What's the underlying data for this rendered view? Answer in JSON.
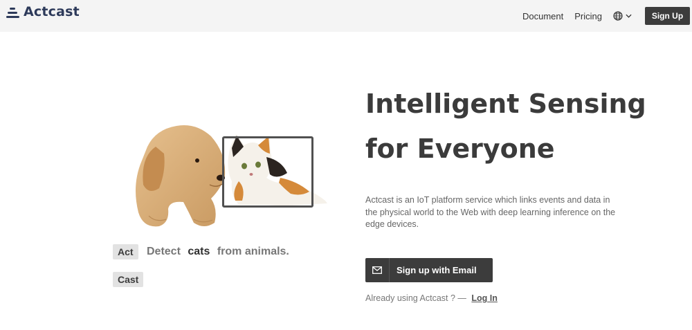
{
  "header": {
    "logo": "Actcast",
    "nav": {
      "document": "Document",
      "pricing": "Pricing",
      "signup": "Sign Up"
    },
    "icons": {
      "language": "globe-icon",
      "dropdown": "chevron-down-icon"
    }
  },
  "hero": {
    "tags": {
      "act": "Act",
      "cast": "Cast"
    },
    "detect": {
      "prefix": "Detect",
      "subject": "cats",
      "suffix": "from animals."
    },
    "title_line1": "Intelligent Sensing",
    "title_line2": "for Everyone",
    "description": "Actcast is an IoT platform service which links events and data in the physical world to the Web with deep learning inference on the edge devices.",
    "email_button": "Sign up with Email",
    "login_prompt": "Already using Actcast ? —",
    "login_link": "Log In"
  },
  "colors": {
    "dark": "#3c3c3c",
    "header_bg": "#f4f4f4",
    "brand": "#2d3a5a"
  }
}
